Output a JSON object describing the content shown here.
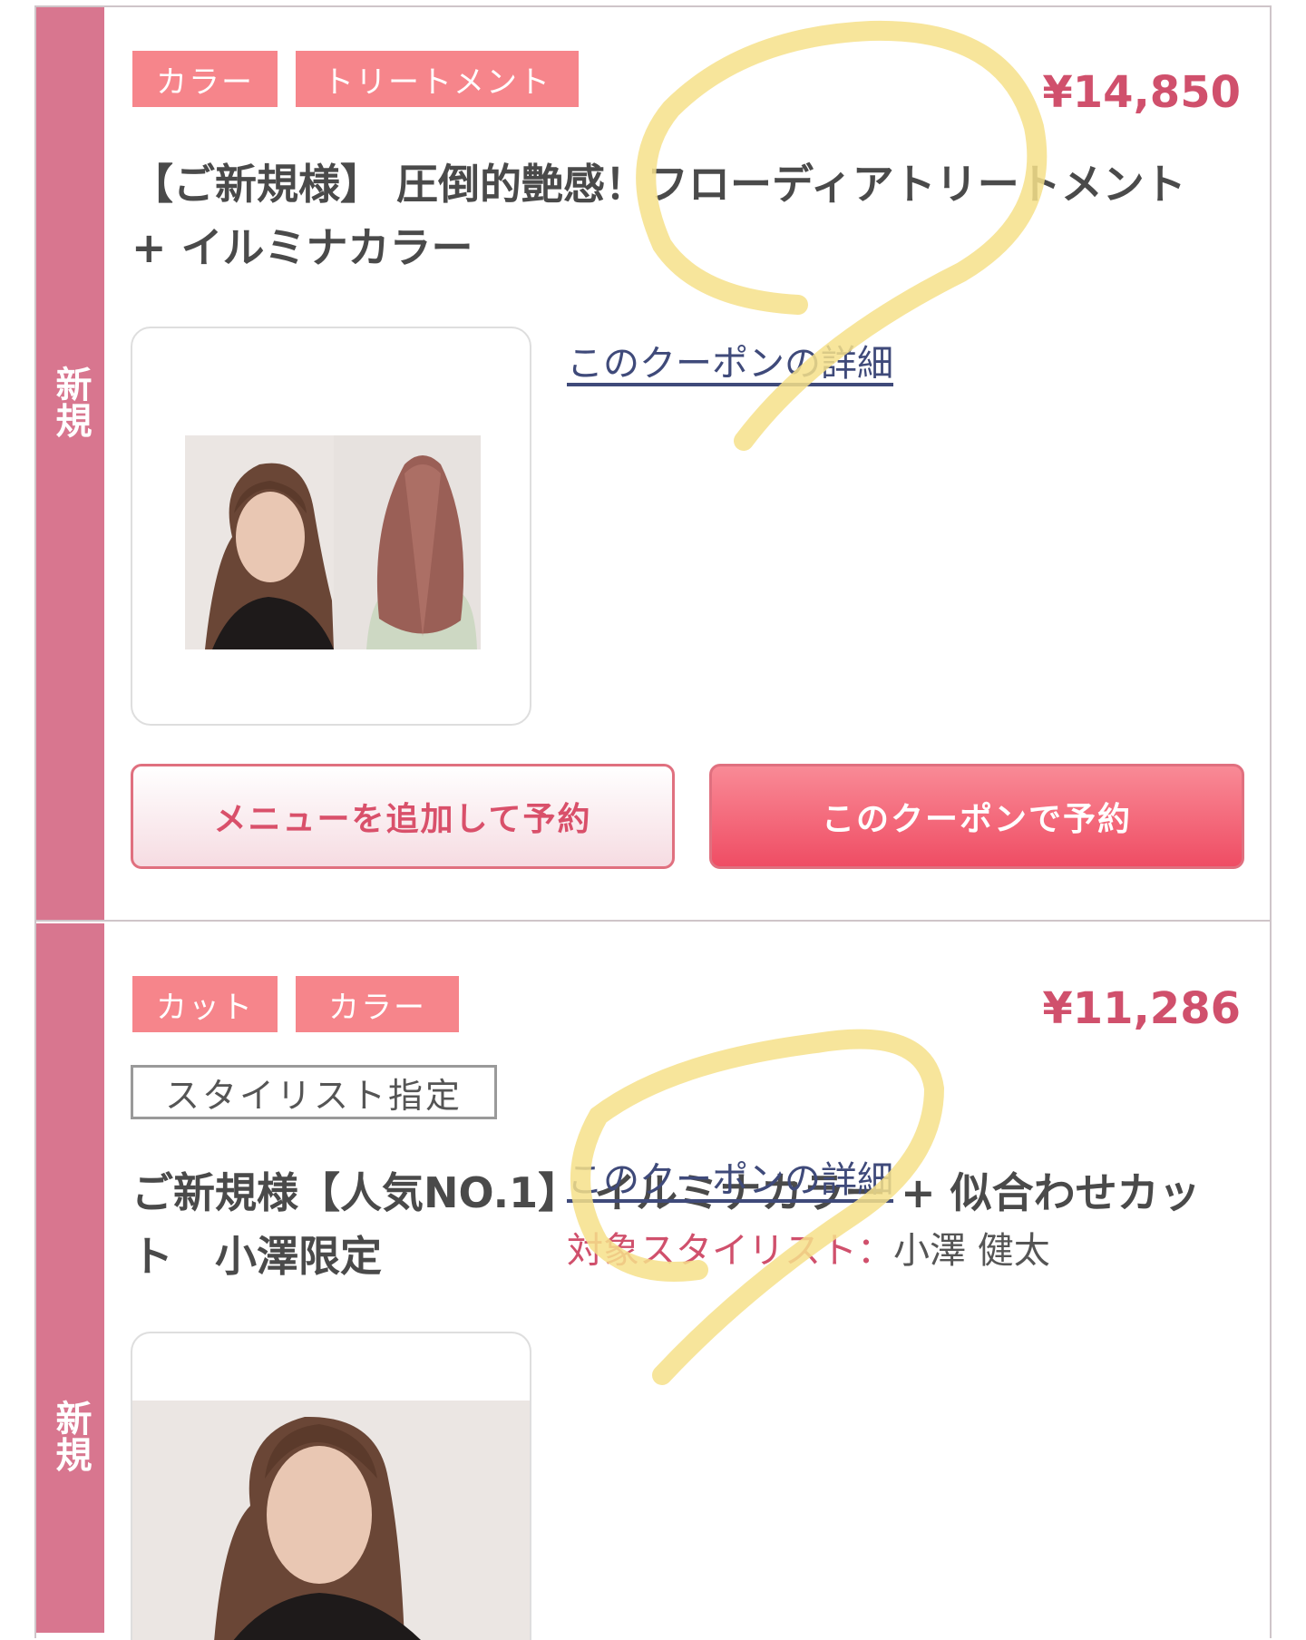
{
  "coupons": [
    {
      "side_label": "新規",
      "tags": [
        "カラー",
        "トリートメント"
      ],
      "price": "¥14,850",
      "title_line1": "【ご新規様】 圧倒的艶感！フローディアトリートメント",
      "title_line2": "+ イルミナカラー",
      "detail_link": "このクーポンの詳細",
      "buttons": {
        "add_menu": "メニューを追加して予約",
        "book": "このクーポンで予約"
      }
    },
    {
      "side_label": "新規",
      "tags": [
        "カット",
        "カラー"
      ],
      "stylist_badge": "スタイリスト指定",
      "price": "¥11,286",
      "title_line1": "ご新規様【人気NO.1】 イルミナカラー + 似合わせカッ",
      "title_line2": "ト　小澤限定",
      "detail_link": "このクーポンの詳細",
      "stylist_key": "対象スタイリスト：",
      "stylist_name": "小澤 健太"
    }
  ],
  "colors": {
    "side_bar": "#d8768f",
    "tag_bg": "#f6858b",
    "price": "#d0506c",
    "link": "#3f4a7a",
    "book_button": "#ef4d64",
    "highlight_marker": "#f6e08a"
  }
}
